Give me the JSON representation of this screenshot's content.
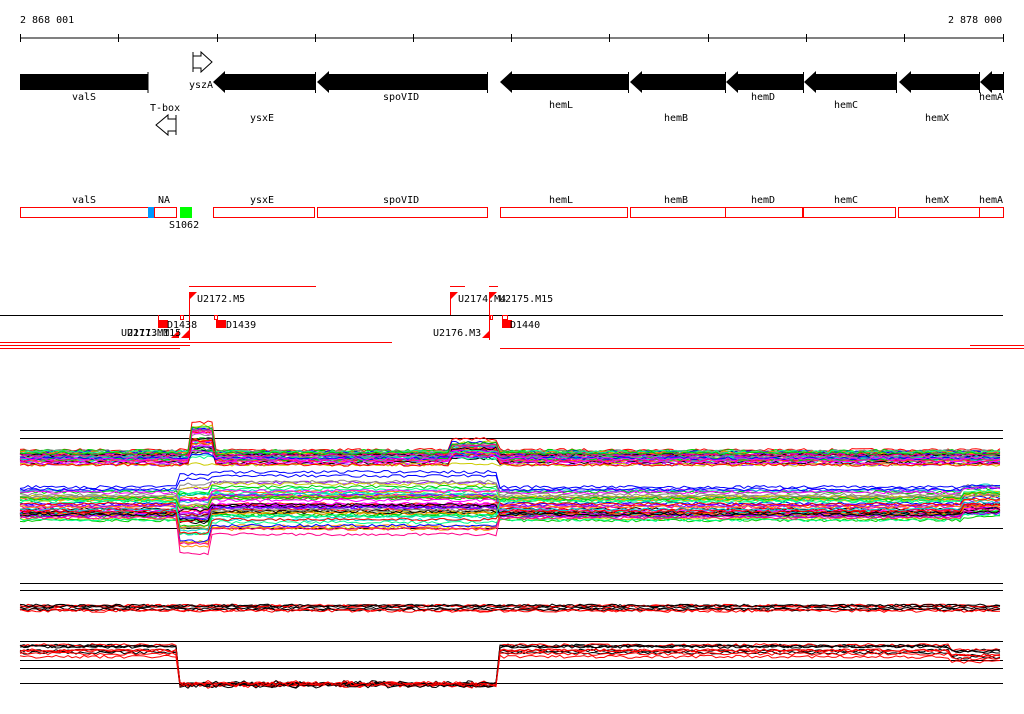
{
  "ruler": {
    "start_label": "2 868 001",
    "end_label": "2 878 000"
  },
  "genes": [
    {
      "name": "valS"
    },
    {
      "name": "yszA"
    },
    {
      "name": "T-box"
    },
    {
      "name": "ysxE"
    },
    {
      "name": "spoVID"
    },
    {
      "name": "hemL"
    },
    {
      "name": "hemB"
    },
    {
      "name": "hemD"
    },
    {
      "name": "hemC"
    },
    {
      "name": "hemX"
    },
    {
      "name": "hemA"
    }
  ],
  "annotations": [
    {
      "name": "valS"
    },
    {
      "name": "NA"
    },
    {
      "name": "ysxE"
    },
    {
      "name": "spoVID"
    },
    {
      "name": "hemL"
    },
    {
      "name": "hemB"
    },
    {
      "name": "hemD"
    },
    {
      "name": "hemC"
    },
    {
      "name": "hemX"
    },
    {
      "name": "hemA"
    }
  ],
  "sites": [
    {
      "name": "S1062"
    }
  ],
  "markers": [
    {
      "name": "U2172.M5"
    },
    {
      "name": "U2174.M4"
    },
    {
      "name": "U2175.M15"
    },
    {
      "name": "D1438"
    },
    {
      "name": "D1439"
    },
    {
      "name": "D1440"
    },
    {
      "name": "U2176.M3"
    },
    {
      "name": "U2171.M1"
    },
    {
      "name": "U2173.M15"
    }
  ],
  "colors": {
    "gene": "#000000",
    "annotation": "#ff0000",
    "promoter": "#0099ff",
    "site": "#00ff00",
    "marker": "#ff0000"
  }
}
